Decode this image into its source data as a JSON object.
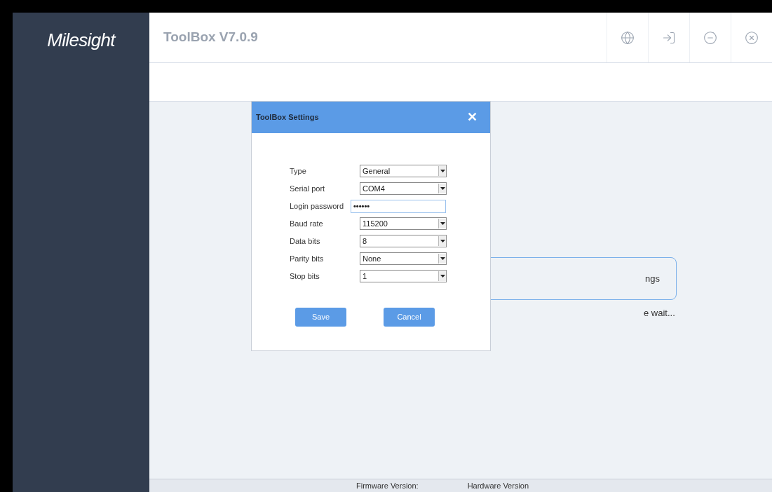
{
  "sidebar": {
    "logo": "Milesight"
  },
  "header": {
    "title": "ToolBox V7.0.9"
  },
  "background": {
    "button_label": "ngs",
    "status_text": "e wait..."
  },
  "dialog": {
    "title": "ToolBox Settings",
    "close": "✕",
    "fields": [
      {
        "label": "Type",
        "kind": "select",
        "value": "General"
      },
      {
        "label": "Serial port",
        "kind": "select",
        "value": "COM4"
      },
      {
        "label": "Login password",
        "kind": "password",
        "value": "••••••"
      },
      {
        "label": "Baud rate",
        "kind": "select",
        "value": "115200"
      },
      {
        "label": "Data bits",
        "kind": "select",
        "value": "8"
      },
      {
        "label": "Parity bits",
        "kind": "select",
        "value": "None"
      },
      {
        "label": "Stop bits",
        "kind": "select",
        "value": "1"
      }
    ],
    "buttons": [
      "Save",
      "Cancel"
    ]
  },
  "footer": {
    "firmware": "Firmware Version:",
    "hardware": "Hardware Version"
  }
}
